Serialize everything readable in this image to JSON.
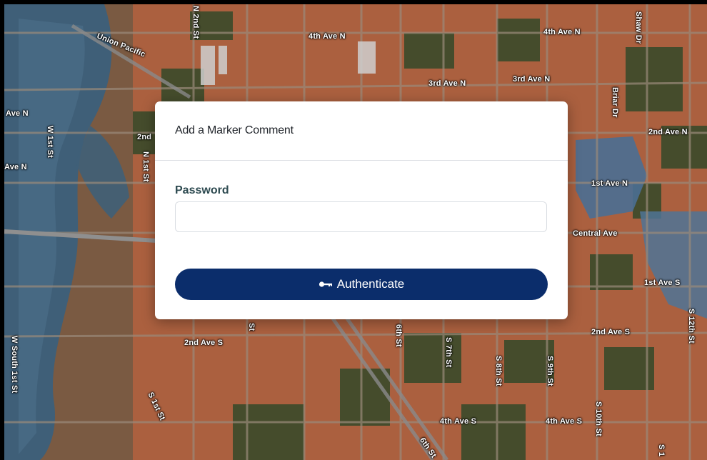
{
  "modal": {
    "title": "Add a Marker Comment",
    "password_label": "Password",
    "password_value": "",
    "password_placeholder": "",
    "button_label": "Authenticate",
    "button_icon": "key-icon"
  },
  "map": {
    "labels": {
      "union_pacific": "Union Pacific",
      "n2nd_st": "N 2nd St",
      "fourth_ave_n_a": "4th Ave N",
      "fourth_ave_n_b": "4th Ave N",
      "shaw_dr": "Shaw Dr",
      "third_ave_n_a": "3rd Ave N",
      "third_ave_n_b": "3rd Ave N",
      "briar_dr": "Briar Dr",
      "ave_n_top": "Ave N",
      "n_1st_st": "N 1st St",
      "w_1st_st": "W 1st St",
      "second_left": "2nd",
      "ave_n_left": "Ave N",
      "n1st_st_left": "N 1st St",
      "second_ave_n": "2nd Ave N",
      "first_ave_n": "1st Ave N",
      "central_ave": "Central Ave",
      "first_ave_s": "1st Ave S",
      "s_12th_st": "S 12th St",
      "second_ave_s_right": "2nd Ave S",
      "second_ave_s_left": "2nd Ave S",
      "st_mid": "St",
      "sixth_st": "6th St",
      "s_7th_st": "S 7th St",
      "s_8th_st": "S 8th St",
      "s_9th_st": "S 9th St",
      "s_10th_st": "S 10th St",
      "w_south_1st_st": "W South 1st St",
      "s_1st_st": "S 1st St",
      "fourth_ave_s_a": "4th Ave S",
      "fourth_ave_s_b": "4th Ave S",
      "sixth_st_bottom": "6th St",
      "s1_bottom": "S 1"
    },
    "colors": {
      "flood_orange": "#c0603a",
      "water_blue": "#3f5f78",
      "vegetation": "#2f4a2c"
    }
  }
}
